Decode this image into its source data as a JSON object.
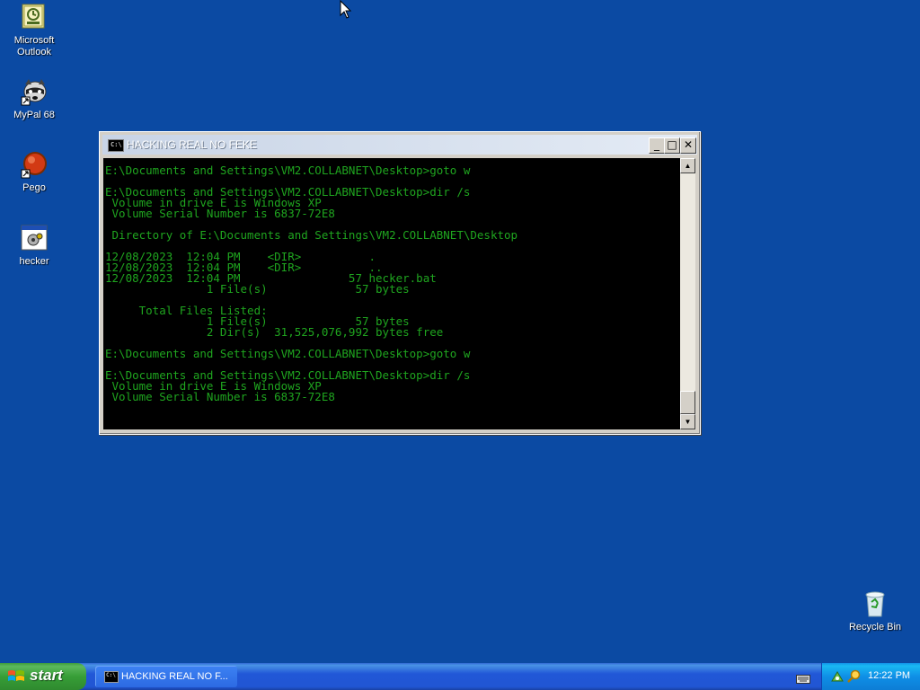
{
  "desktop": {
    "icons": [
      {
        "label": "Microsoft Outlook",
        "line1": "Microsoft",
        "line2": "Outlook"
      },
      {
        "label": "MyPal 68"
      },
      {
        "label": "Pego"
      },
      {
        "label": "hecker"
      },
      {
        "label": "Recycle Bin"
      }
    ]
  },
  "window": {
    "title": "HACKING REAL NO FEKE",
    "icon_text": "C:\\",
    "buttons": {
      "minimize": "_",
      "maximize": "□",
      "close": "✕"
    },
    "console_text": "E:\\Documents and Settings\\VM2.COLLABNET\\Desktop>goto w\n\nE:\\Documents and Settings\\VM2.COLLABNET\\Desktop>dir /s\n Volume in drive E is Windows XP\n Volume Serial Number is 6837-72E8\n\n Directory of E:\\Documents and Settings\\VM2.COLLABNET\\Desktop\n\n12/08/2023  12:04 PM    <DIR>          .\n12/08/2023  12:04 PM    <DIR>          ..\n12/08/2023  12:04 PM                57 hecker.bat\n               1 File(s)             57 bytes\n\n     Total Files Listed:\n               1 File(s)             57 bytes\n               2 Dir(s)  31,525,076,992 bytes free\n\nE:\\Documents and Settings\\VM2.COLLABNET\\Desktop>goto w\n\nE:\\Documents and Settings\\VM2.COLLABNET\\Desktop>dir /s\n Volume in drive E is Windows XP\n Volume Serial Number is 6837-72E8"
  },
  "taskbar": {
    "start_label": "start",
    "task_label": "HACKING REAL NO F...",
    "clock": "12:22 PM"
  },
  "colors": {
    "desktop": "#0b4aa3",
    "console_bg": "#000000",
    "console_text": "#1fa51f"
  }
}
